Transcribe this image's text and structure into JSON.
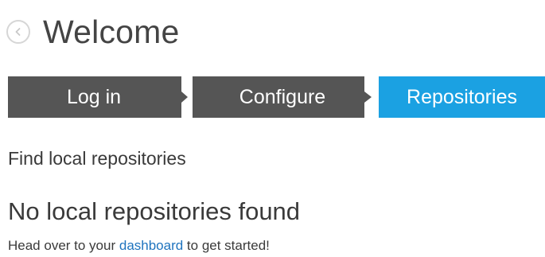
{
  "header": {
    "title": "Welcome",
    "back_icon": "chevron-left-icon"
  },
  "steps": [
    {
      "label": "Log in",
      "state": "completed"
    },
    {
      "label": "Configure",
      "state": "completed"
    },
    {
      "label": "Repositories",
      "state": "active"
    }
  ],
  "colors": {
    "step_inactive": "#555555",
    "step_active": "#1ba1e2",
    "link": "#1e73be"
  },
  "content": {
    "subtitle": "Find local repositories",
    "empty_title": "No local repositories found",
    "message_prefix": "Head over to your ",
    "link_text": "dashboard",
    "message_suffix": " to get started!"
  }
}
